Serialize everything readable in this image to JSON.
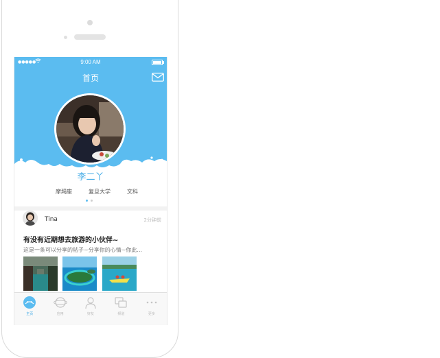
{
  "status_bar": {
    "signal": "●●●●●",
    "time": "9:00 AM"
  },
  "header": {
    "title": "首页",
    "mail_icon": "mail-icon"
  },
  "profile": {
    "name": "李二丫",
    "tags": [
      "摩羯座",
      "复旦大学",
      "文科"
    ]
  },
  "post": {
    "user": "Tina",
    "time": "2分钟前",
    "title": "有没有近期想去旅游的小伙伴~",
    "text": "这是一条可以分享的帖子~分享你的心情~你此..."
  },
  "tabs": [
    {
      "label": "主页",
      "icon": "home-icon",
      "active": true
    },
    {
      "label": "应用",
      "icon": "planet-icon",
      "active": false
    },
    {
      "label": "好友",
      "icon": "user-icon",
      "active": false
    },
    {
      "label": "频道",
      "icon": "chat-icon",
      "active": false
    },
    {
      "label": "更多",
      "icon": "more-icon",
      "active": false
    }
  ],
  "colors": {
    "accent": "#5bbcf0",
    "name": "#3fa9e6"
  }
}
